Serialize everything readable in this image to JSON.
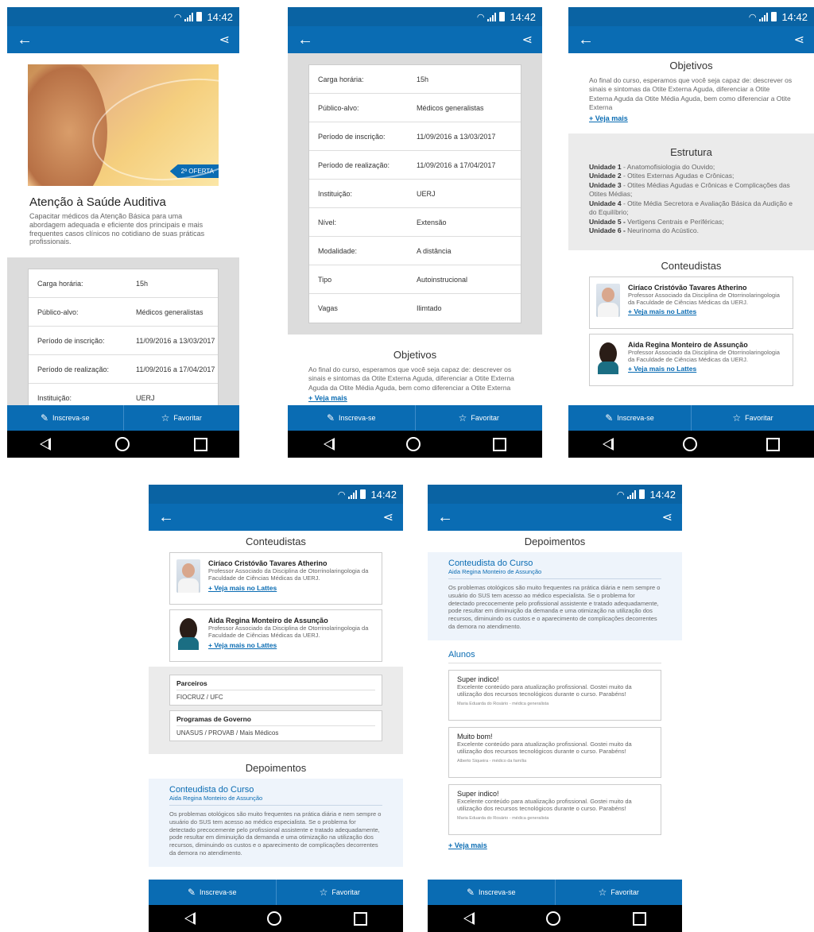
{
  "status": {
    "time": "14:42"
  },
  "bottom_bar": {
    "enroll": "Inscreva-se",
    "favorite": "Favoritar"
  },
  "course": {
    "badge": "2ª OFERTA",
    "title": "Atenção à Saúde Auditiva",
    "description": "Capacitar médicos da Atenção Básica para uma abordagem adequada e eficiente dos principais e mais frequentes casos clínicos no cotidiano de suas práticas profissionais."
  },
  "details": [
    {
      "label": "Carga horária:",
      "value": "15h"
    },
    {
      "label": "Público-alvo:",
      "value": "Médicos generalistas"
    },
    {
      "label": "Período de inscrição:",
      "value": "11/09/2016 a 13/03/2017"
    },
    {
      "label": "Período de realização:",
      "value": "11/09/2016 a 17/04/2017"
    },
    {
      "label": "Instituição:",
      "value": "UERJ"
    },
    {
      "label": "Nível:",
      "value": "Extensão"
    },
    {
      "label": "Modalidade:",
      "value": "A distância"
    },
    {
      "label": "Tipo",
      "value": "Autoinstrucional"
    },
    {
      "label": "Vagas",
      "value": "Ilimtado"
    }
  ],
  "objetivos": {
    "title": "Objetivos",
    "text": "Ao final do curso, esperamos que você seja capaz de: descrever os sinais e sintomas da Otite Externa Aguda, diferenciar a Otite Externa Aguda da Otite Média Aguda, bem como diferenciar a Otite Externa",
    "more": "+ Veja mais"
  },
  "estrutura": {
    "title": "Estrutura",
    "units": [
      {
        "name": "Unidade 1",
        "text": " - Anatomofisiologia do Ouvido;"
      },
      {
        "name": "Unidade 2",
        "text": " - Otites Externas Agudas e Crônicas;"
      },
      {
        "name": "Unidade 3",
        "text": " - Otites Médias Agudas e Crônicas e Complicações das Otites Médias;"
      },
      {
        "name": "Unidade 4",
        "text": " - Otite Média Secretora e Avaliação Básica da Audição e do Equilíbrio;"
      },
      {
        "name": "Unidade 5 -",
        "text": " Vertigens Centrais e Periféricas;"
      },
      {
        "name": "Unidade 6 -",
        "text": " Neurinoma do Acústico."
      }
    ]
  },
  "conteudistas": {
    "title": "Conteudistas",
    "people": [
      {
        "name": "Ciríaco Cristóvão Tavares Atherino",
        "desc": "Professor Associado da Disciplina de Otorrinolaringologia da Faculdade de Ciências Médicas da UERJ.",
        "link": "+ Veja mais no Lattes"
      },
      {
        "name": "Aida Regina Monteiro de Assunção",
        "desc": "Professor Associado da Disciplina de Otorrinolaringologia da Faculdade de Ciências Médicas da UERJ.",
        "link": "+ Veja mais no Lattes"
      }
    ]
  },
  "parceiros": {
    "label": "Parceiros",
    "value": "FIOCRUZ / UFC"
  },
  "programas": {
    "label": "Programas de Governo",
    "value": "UNASUS / PROVAB / Mais Médicos"
  },
  "depoimentos": {
    "title": "Depoimentos",
    "conteudista_title": "Conteudista do Curso",
    "conteudista_name": "Aida Regina Monteiro de Assunção",
    "conteudista_text": "Os problemas otológicos são muito frequentes na prática diária e nem sempre o usuário do SUS tem acesso ao médico especialista. Se o problema for detectado precocemente pelo profissional assistente e tratado adequadamente, pode resultar em diminuição da demanda e uma otimização na utilização dos recursos, diminuindo os custos e o aparecimento de complicações decorrentes da demora no atendimento.",
    "alunos_title": "Alunos",
    "alunos": [
      {
        "title": "Super indico!",
        "text": "Excelente conteúdo para atualização profissional. Gostei muito da utilização dos recursos tecnológicos durante o curso. Parabéns!",
        "author": "Maria Eduarda do Rosário - médica generalista"
      },
      {
        "title": "Muito bom!",
        "text": "Excelente conteúdo para atualização profissional. Gostei muito da utilização dos recursos tecnológicos durante o curso. Parabéns!",
        "author": "Alberto Siqueira - médico da família"
      },
      {
        "title": "Super indico!",
        "text": "Excelente conteúdo para atualização profissional. Gostei muito da utilização dos recursos tecnológicos durante o curso. Parabéns!",
        "author": "Maria Eduarda do Rosário - médica generalista"
      }
    ],
    "more": "+ Veja mais"
  }
}
